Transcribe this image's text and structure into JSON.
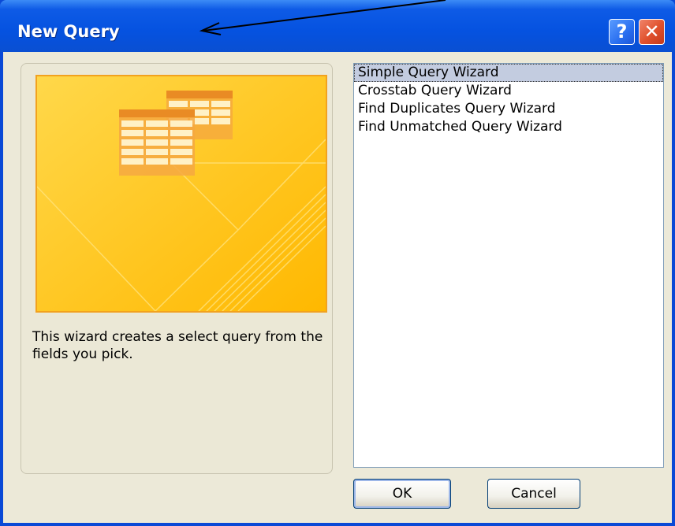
{
  "window": {
    "title": "New Query"
  },
  "titlebar": {
    "help_label": "?",
    "close_label": "✕"
  },
  "preview": {
    "description": "This wizard creates a select query from the fields you pick."
  },
  "wizards": [
    {
      "label": "Simple Query Wizard",
      "selected": true
    },
    {
      "label": "Crosstab Query Wizard",
      "selected": false
    },
    {
      "label": "Find Duplicates Query Wizard",
      "selected": false
    },
    {
      "label": "Find Unmatched Query Wizard",
      "selected": false
    }
  ],
  "buttons": {
    "ok_label": "OK",
    "cancel_label": "Cancel"
  },
  "colors": {
    "titlebar": "#0552e0",
    "dialog_bg": "#ece9d8",
    "preview_orange": "#ffc62a",
    "selection": "#c3cce0"
  }
}
